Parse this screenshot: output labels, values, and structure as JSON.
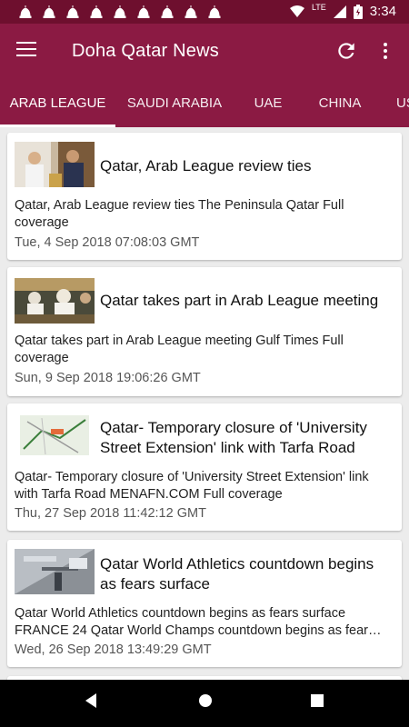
{
  "status_bar": {
    "time": "3:34",
    "network": "LTE",
    "notification_icons": [
      "mosque-icon",
      "mosque-icon",
      "mosque-icon",
      "mosque-icon",
      "mosque-icon",
      "mosque-icon",
      "mosque-icon",
      "mosque-icon",
      "mosque-icon"
    ]
  },
  "app_bar": {
    "title": "Doha Qatar News",
    "menu_icon": "hamburger-menu-icon",
    "refresh_icon": "refresh-icon",
    "more_icon": "more-vert-icon"
  },
  "tabs": [
    {
      "label": "ARAB LEAGUE",
      "active": true
    },
    {
      "label": "SAUDI ARABIA",
      "active": false
    },
    {
      "label": "UAE",
      "active": false
    },
    {
      "label": "CHINA",
      "active": false
    },
    {
      "label": "US",
      "active": false
    }
  ],
  "articles": [
    {
      "headline": "Qatar, Arab League review ties",
      "description": "Qatar, Arab League review ties  The Peninsula Qatar  Full coverage",
      "date": "Tue, 4 Sep 2018 07:08:03 GMT"
    },
    {
      "headline": "Qatar takes part in Arab League meeting",
      "description": "Qatar takes part in Arab League meeting  Gulf Times  Full coverage",
      "date": "Sun, 9 Sep 2018 19:06:26 GMT"
    },
    {
      "headline": "Qatar- Temporary closure of 'University Street Extension' link with Tarfa Road",
      "description": "Qatar- Temporary closure of 'University Street Extension' link with Tarfa Road  MENAFN.COM  Full coverage",
      "date": "Thu, 27 Sep 2018 11:42:12 GMT"
    },
    {
      "headline": "Qatar World Athletics countdown begins as fears surface",
      "description": "Qatar World Athletics countdown begins as fears surface FRANCE 24  Qatar World Champs countdown begins as fear…",
      "date": "Wed, 26 Sep 2018 13:49:29 GMT"
    }
  ],
  "colors": {
    "status_bar": "#6e0f2e",
    "primary": "#8b1a43",
    "background": "#ececec",
    "card": "#ffffff",
    "nav_bar": "#000000"
  },
  "nav_bar": {
    "back_icon": "back-icon",
    "home_icon": "home-icon",
    "recents_icon": "recents-icon"
  }
}
